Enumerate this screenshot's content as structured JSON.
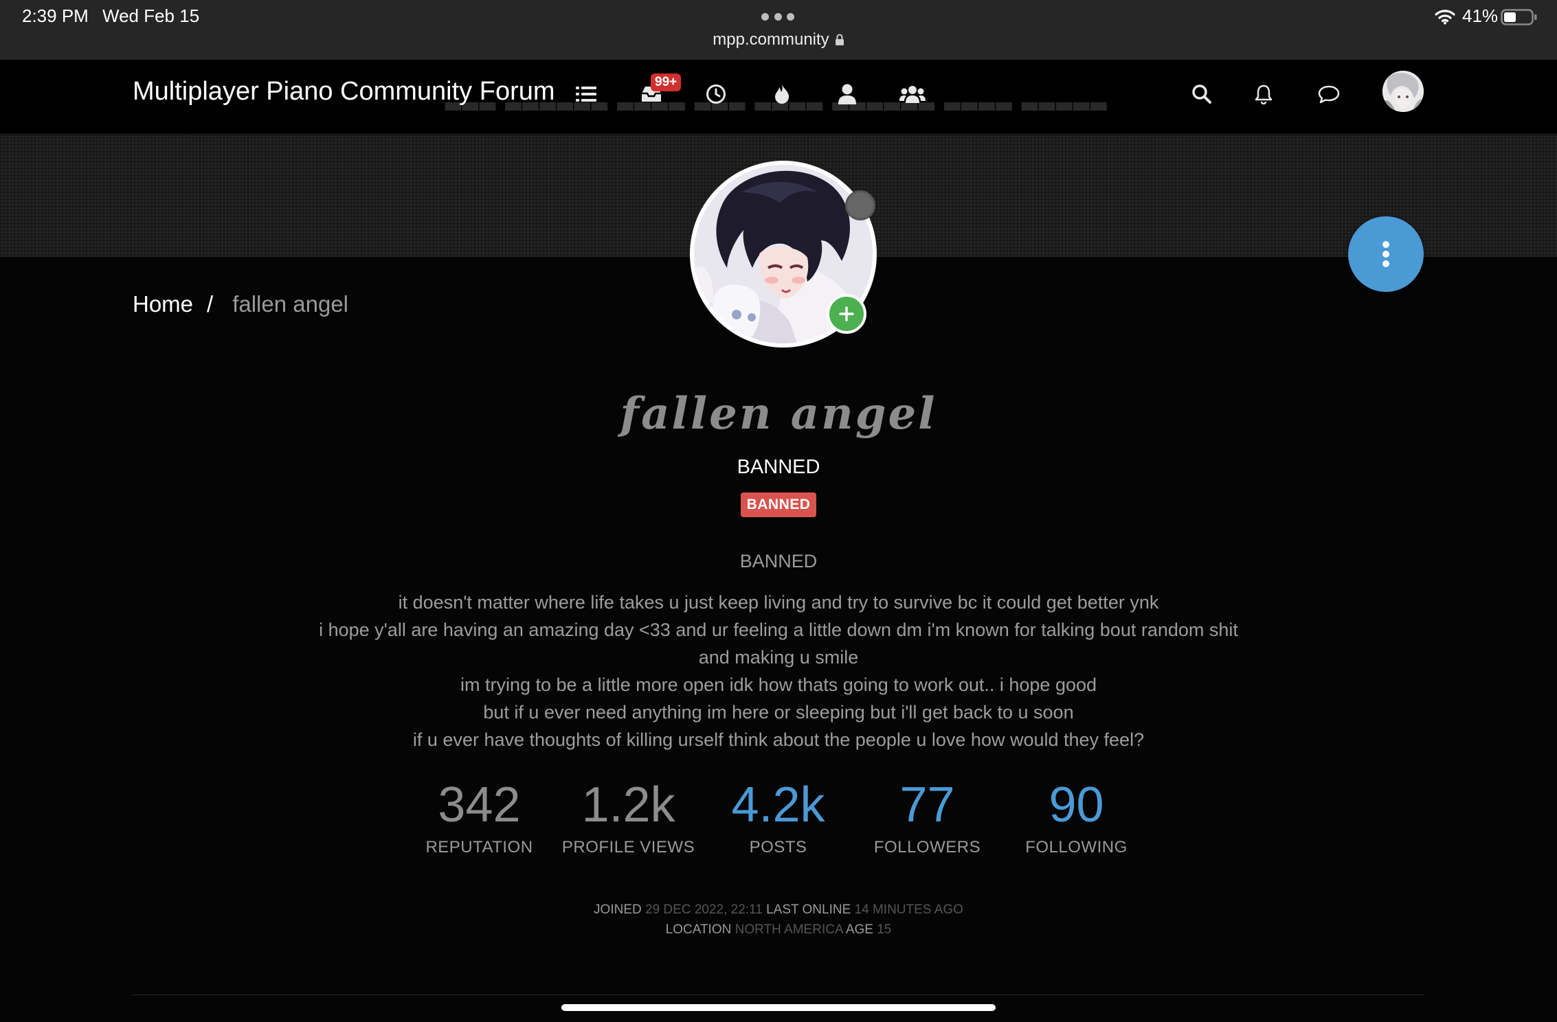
{
  "status_bar": {
    "time": "2:39 PM",
    "date": "Wed Feb 15",
    "url": "mpp.community",
    "battery": "41%",
    "icons": [
      "wifi-icon",
      "battery-icon",
      "lock-icon"
    ]
  },
  "header": {
    "site_title": "Multiplayer Piano Community Forum",
    "unread_badge": "99+",
    "nav_icons": [
      "categories-icon",
      "unread-inbox-icon",
      "recent-icon",
      "popular-icon",
      "users-icon",
      "groups-icon"
    ],
    "right_icons": [
      "search-icon",
      "notifications-icon",
      "chat-icon",
      "user-avatar"
    ]
  },
  "breadcrumb": {
    "home": "Home",
    "separator": "/",
    "current": "fallen angel"
  },
  "profile": {
    "display_name": "fallen angel",
    "group_title": "BANNED",
    "badge": "BANNED",
    "status_label": "BANNED",
    "bio_lines": [
      "it doesn't matter where life takes u just keep living and try to survive bc it could get better ynk",
      "i hope y'all are having an amazing day <33 and ur feeling a little down dm i'm known for talking bout random shit",
      "and making u smile",
      "im trying to be a little more open idk how thats going to work out.. i hope good",
      "but if u ever need anything im here or sleeping but i'll get back to u soon",
      "if u ever have thoughts of killing urself think about the people u love how would they feel?"
    ],
    "colors": {
      "accent": "#4a9ad6",
      "banned_badge": "#d9534f",
      "online_plus": "#4caf50",
      "status_offline": "#666666"
    }
  },
  "stats": [
    {
      "value": "342",
      "label": "REPUTATION"
    },
    {
      "value": "1.2k",
      "label": "PROFILE VIEWS"
    },
    {
      "value": "4.2k",
      "label": "POSTS"
    },
    {
      "value": "77",
      "label": "FOLLOWERS"
    },
    {
      "value": "90",
      "label": "FOLLOWING"
    }
  ],
  "meta": {
    "joined_label": "JOINED",
    "joined_value": "29 DEC 2022, 22:11",
    "last_online_label": "LAST ONLINE",
    "last_online_value": "14 MINUTES AGO",
    "location_label": "LOCATION",
    "location_value": "NORTH AMERICA",
    "age_label": "AGE",
    "age_value": "15"
  }
}
